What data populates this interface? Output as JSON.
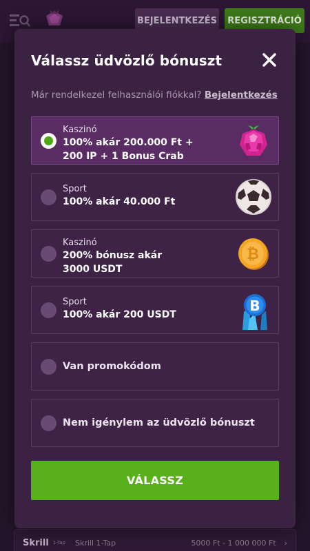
{
  "header": {
    "login_label": "BEJELENTKEZÉS",
    "register_label": "REGISZTRÁCIÓ"
  },
  "background_row": {
    "brand": "Skrill",
    "brand_sub": "1-Tap",
    "method": "Skrill 1-Tap",
    "range": "5000 Ft - 1 000 000 Ft"
  },
  "modal": {
    "title": "Válassz üdvözlő bónuszt",
    "subtitle": "Már rendelkezel felhasználói fiókkal?",
    "subtitle_link": "Bejelentkezés",
    "options": [
      {
        "category": "Kaszinó",
        "line1": "100% akár 200.000 Ft +",
        "line2": "200 IP + 1 Bonus Crab",
        "icon": "raspberry-icon",
        "selected": true
      },
      {
        "category": "Sport",
        "line1": "100% akár 40.000 Ft",
        "line2": "",
        "icon": "soccer-ball-icon",
        "selected": false
      },
      {
        "category": "Kaszinó",
        "line1": "200% bónusz akár",
        "line2": "3000 USDT",
        "icon": "bitcoin-coin-icon",
        "selected": false
      },
      {
        "category": "Sport",
        "line1": "100% akár 200 USDT",
        "line2": "",
        "icon": "bitcoin-crystal-icon",
        "selected": false
      },
      {
        "category": "",
        "line1": "Van promokódom",
        "line2": "",
        "icon": "",
        "selected": false
      },
      {
        "category": "",
        "line1": "Nem igénylem az üdvözlő bónuszt",
        "line2": "",
        "icon": "",
        "selected": false
      }
    ],
    "submit_label": "VÁLASSZ"
  },
  "colors": {
    "accent_green": "#58b01b",
    "modal_bg": "#3b2142",
    "selected_option": "#5a2c64"
  }
}
